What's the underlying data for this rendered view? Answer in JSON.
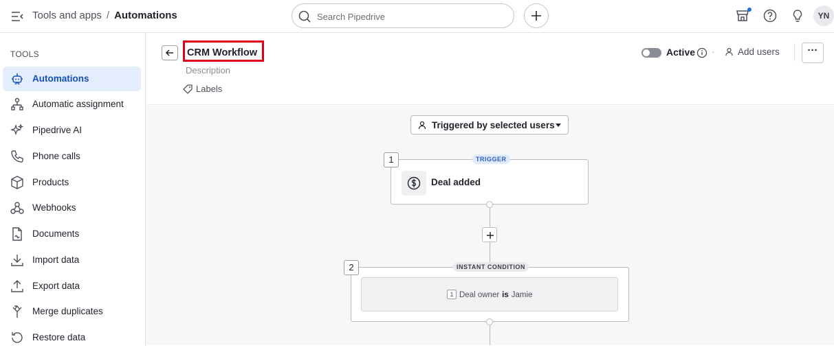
{
  "breadcrumb": {
    "parent": "Tools and apps",
    "separator": "/",
    "current": "Automations"
  },
  "search": {
    "placeholder": "Search Pipedrive"
  },
  "user": {
    "initials": "YN"
  },
  "sidebar": {
    "title": "TOOLS",
    "items": [
      {
        "label": "Automations",
        "icon": "automation-bot-icon",
        "active": true
      },
      {
        "label": "Automatic assignment",
        "icon": "assignment-icon"
      },
      {
        "label": "Pipedrive AI",
        "icon": "sparkle-icon"
      },
      {
        "label": "Phone calls",
        "icon": "phone-icon"
      },
      {
        "label": "Products",
        "icon": "box-icon"
      },
      {
        "label": "Webhooks",
        "icon": "webhook-icon"
      },
      {
        "label": "Documents",
        "icon": "document-icon"
      },
      {
        "label": "Import data",
        "icon": "download-icon"
      },
      {
        "label": "Export data",
        "icon": "upload-icon"
      },
      {
        "label": "Merge duplicates",
        "icon": "merge-icon"
      },
      {
        "label": "Restore data",
        "icon": "restore-icon"
      }
    ]
  },
  "workflow": {
    "title": "CRM Workflow",
    "description_placeholder": "Description",
    "labels": "Labels",
    "status_label": "Active",
    "status_on": false,
    "separator": "·",
    "add_users": "Add users",
    "more": "···"
  },
  "canvas": {
    "trigger_scope": "Triggered by selected users",
    "steps": [
      {
        "number": "1",
        "badge": "TRIGGER",
        "label": "Deal added",
        "icon": "dollar-icon"
      },
      {
        "number": "2",
        "badge": "INSTANT CONDITION",
        "condition": {
          "index": "1",
          "field": "Deal owner",
          "operator": "is",
          "value": "Jamie"
        }
      }
    ]
  },
  "colors": {
    "accent": "#1551b5",
    "active_bg": "#e3edfb",
    "highlight_border": "#e0001b",
    "trigger_badge": "#dfeafb"
  }
}
